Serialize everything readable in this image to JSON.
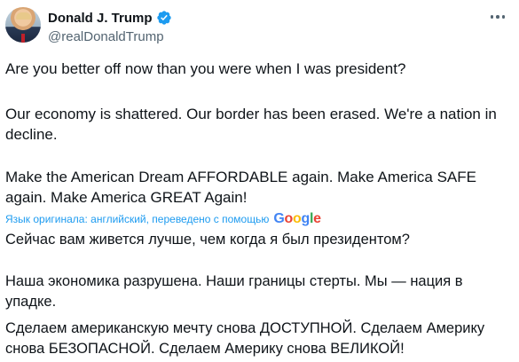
{
  "author": {
    "name": "Donald J. Trump",
    "handle": "@realDonaldTrump",
    "verified": true,
    "avatar_icon": "profile-photo"
  },
  "colors": {
    "verified": "#1d9bf0",
    "attribution": "#1d9bf0",
    "text": "#0f1419",
    "muted": "#536471"
  },
  "tweet": {
    "paragraphs": [
      "Are you better off now than you were when I was president?",
      "Our economy is shattered. Our border has been erased. We're a nation in decline.",
      "Make the American Dream AFFORDABLE again. Make America SAFE again. Make America GREAT Again!"
    ]
  },
  "translation": {
    "attribution": "Язык оригинала: английский, переведено с помощью",
    "provider": "Google",
    "paragraphs": [
      "Сейчас вам живется лучше, чем когда я был президентом?",
      "Наша экономика разрушена. Наши границы стерты. Мы — нация в упадке.",
      "Сделаем американскую мечту снова ДОСТУПНОЙ. Сделаем Америку снова БЕЗОПАСНОЙ. Сделаем Америку снова ВЕЛИКОЙ!"
    ]
  }
}
